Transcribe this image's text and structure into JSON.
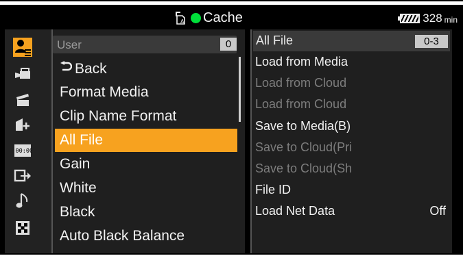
{
  "status": {
    "media_label": "Cache",
    "media_indicator_color": "#00e03a",
    "battery_value": "328",
    "battery_unit": "min"
  },
  "left_icons": [
    {
      "name": "user-icon",
      "selected": true
    },
    {
      "name": "camera-icon",
      "selected": false
    },
    {
      "name": "clapper-icon",
      "selected": false
    },
    {
      "name": "lens-plus-icon",
      "selected": false
    },
    {
      "name": "timecode-icon",
      "selected": false
    },
    {
      "name": "output-icon",
      "selected": false
    },
    {
      "name": "audio-note-icon",
      "selected": false
    },
    {
      "name": "grid-icon",
      "selected": false
    }
  ],
  "menu": {
    "header": {
      "label": "User",
      "count": "0"
    },
    "items": [
      {
        "label": "Back",
        "selected": false
      },
      {
        "label": "Format Media",
        "selected": false
      },
      {
        "label": "Clip Name Format",
        "selected": false
      },
      {
        "label": "All File",
        "selected": true
      },
      {
        "label": "Gain",
        "selected": false
      },
      {
        "label": "White",
        "selected": false
      },
      {
        "label": "Black",
        "selected": false
      },
      {
        "label": "Auto Black Balance",
        "selected": false
      }
    ]
  },
  "submenu": {
    "header": {
      "label": "All File",
      "range": "0-3"
    },
    "items": [
      {
        "label": "Load from Media",
        "enabled": true
      },
      {
        "label": "Load from Cloud",
        "enabled": false
      },
      {
        "label": "Load from Cloud",
        "enabled": false
      },
      {
        "label": "Save to Media(B)",
        "enabled": true
      },
      {
        "label": "Save to Cloud(Pri",
        "enabled": false
      },
      {
        "label": "Save to Cloud(Sh",
        "enabled": false
      },
      {
        "label": "File ID",
        "enabled": true
      },
      {
        "label": "Load Net Data",
        "enabled": true,
        "value": "Off"
      }
    ]
  },
  "colors": {
    "accent": "#f7a21f",
    "background": "#000000",
    "panel": "#1f1f1f"
  }
}
